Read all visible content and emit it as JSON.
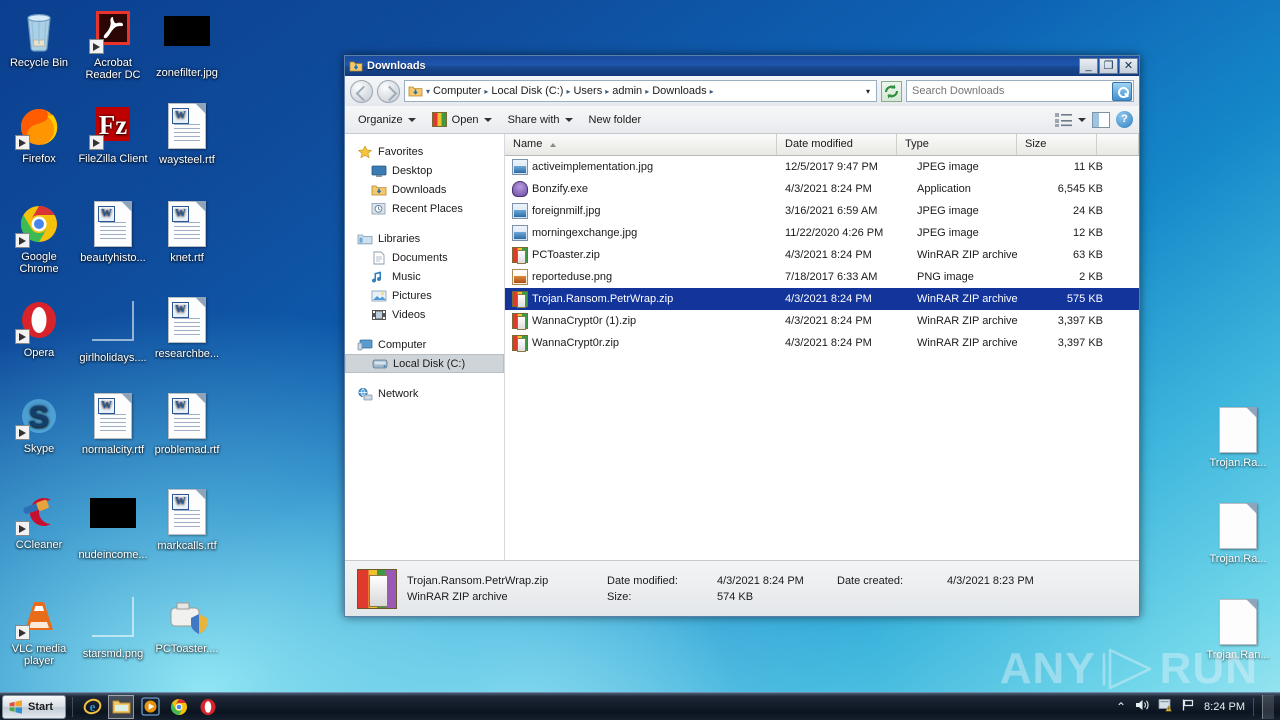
{
  "desktop": {
    "icons": [
      {
        "label": "Recycle Bin",
        "icon": "recycle-bin-icon",
        "kind": "recycle"
      },
      {
        "label": "Acrobat Reader DC",
        "icon": "acrobat-reader-icon",
        "kind": "acrobat"
      },
      {
        "label": "zonefilter.jpg",
        "icon": "image-file-icon",
        "kind": "black"
      },
      {
        "label": "Firefox",
        "icon": "firefox-icon",
        "kind": "firefox"
      },
      {
        "label": "FileZilla Client",
        "icon": "filezilla-icon",
        "kind": "filezilla"
      },
      {
        "label": "waysteel.rtf",
        "icon": "rtf-document-icon",
        "kind": "word"
      },
      {
        "label": "Google Chrome",
        "icon": "chrome-icon",
        "kind": "chrome"
      },
      {
        "label": "beautyhisto...",
        "icon": "rtf-document-icon",
        "kind": "word"
      },
      {
        "label": "knet.rtf",
        "icon": "rtf-document-icon",
        "kind": "word"
      },
      {
        "label": "Opera",
        "icon": "opera-icon",
        "kind": "opera"
      },
      {
        "label": "girlholidays....",
        "icon": "image-file-icon",
        "kind": "empty"
      },
      {
        "label": "researchbe...",
        "icon": "rtf-document-icon",
        "kind": "word"
      },
      {
        "label": "Skype",
        "icon": "skype-icon",
        "kind": "skype"
      },
      {
        "label": "normalcity.rtf",
        "icon": "rtf-document-icon",
        "kind": "word"
      },
      {
        "label": "problemad.rtf",
        "icon": "rtf-document-icon",
        "kind": "word"
      },
      {
        "label": "CCleaner",
        "icon": "ccleaner-icon",
        "kind": "ccleaner"
      },
      {
        "label": "nudeincome...",
        "icon": "image-file-icon",
        "kind": "black"
      },
      {
        "label": "markcalls.rtf",
        "icon": "rtf-document-icon",
        "kind": "word"
      },
      {
        "label": "VLC media player",
        "icon": "vlc-icon",
        "kind": "vlc"
      },
      {
        "label": "starsmd.png",
        "icon": "image-file-icon",
        "kind": "empty"
      },
      {
        "label": "PCToaster....",
        "icon": "pctoaster-icon",
        "kind": "toaster"
      }
    ],
    "right_icons": [
      {
        "label": "Trojan.Ra...",
        "icon": "blank-file-icon"
      },
      {
        "label": "Trojan.Ra...",
        "icon": "blank-file-icon"
      },
      {
        "label": "Trojan.Ran...",
        "icon": "blank-file-icon"
      }
    ],
    "watermark": {
      "text_left": "ANY",
      "text_right": "RUN",
      "icon": "play-triangle-icon"
    }
  },
  "window": {
    "title": "Downloads",
    "title_icon": "downloads-folder-icon",
    "controls": {
      "minimize": "_",
      "maximize": "❐",
      "close": "✕"
    },
    "address": {
      "folder_icon": "downloads-folder-icon",
      "crumbs": [
        "Computer",
        "Local Disk (C:)",
        "Users",
        "admin",
        "Downloads"
      ],
      "separator": "▸",
      "dropdown_caret": "▾",
      "refresh_icon": "refresh-icon"
    },
    "search": {
      "placeholder": "Search Downloads",
      "value": "",
      "icon": "search-icon"
    },
    "toolbar": {
      "organize": "Organize",
      "open": "Open",
      "open_icon": "winrar-open-icon",
      "share_with": "Share with",
      "new_folder": "New folder",
      "view_icon": "view-list-icon",
      "preview_pane_icon": "preview-pane-icon",
      "help_icon": "help-icon",
      "help_glyph": "?"
    },
    "nav": {
      "groups": [
        {
          "header": {
            "label": "Favorites",
            "icon": "star-icon"
          },
          "items": [
            {
              "label": "Desktop",
              "icon": "desktop-icon"
            },
            {
              "label": "Downloads",
              "icon": "downloads-folder-icon"
            },
            {
              "label": "Recent Places",
              "icon": "recent-places-icon"
            }
          ]
        },
        {
          "header": {
            "label": "Libraries",
            "icon": "libraries-icon"
          },
          "items": [
            {
              "label": "Documents",
              "icon": "documents-icon"
            },
            {
              "label": "Music",
              "icon": "music-icon"
            },
            {
              "label": "Pictures",
              "icon": "pictures-icon"
            },
            {
              "label": "Videos",
              "icon": "videos-icon"
            }
          ]
        },
        {
          "header": {
            "label": "Computer",
            "icon": "computer-icon"
          },
          "items": [
            {
              "label": "Local Disk (C:)",
              "icon": "hard-disk-icon",
              "selected": true
            }
          ]
        },
        {
          "header": {
            "label": "Network",
            "icon": "network-icon"
          },
          "items": []
        }
      ]
    },
    "columns": [
      {
        "label": "Name",
        "sorted": "asc"
      },
      {
        "label": "Date modified"
      },
      {
        "label": "Type"
      },
      {
        "label": "Size"
      }
    ],
    "files": [
      {
        "name": "activeimplementation.jpg",
        "modified": "12/5/2017 9:47 PM",
        "type": "JPEG image",
        "size": "11 KB",
        "icon": "jpeg"
      },
      {
        "name": "Bonzify.exe",
        "modified": "4/3/2021 8:24 PM",
        "type": "Application",
        "size": "6,545 KB",
        "icon": "exe"
      },
      {
        "name": "foreignmilf.jpg",
        "modified": "3/16/2021 6:59 AM",
        "type": "JPEG image",
        "size": "24 KB",
        "icon": "jpeg"
      },
      {
        "name": "morningexchange.jpg",
        "modified": "11/22/2020 4:26 PM",
        "type": "JPEG image",
        "size": "12 KB",
        "icon": "jpeg"
      },
      {
        "name": "PCToaster.zip",
        "modified": "4/3/2021 8:24 PM",
        "type": "WinRAR ZIP archive",
        "size": "63 KB",
        "icon": "zip"
      },
      {
        "name": "reporteduse.png",
        "modified": "7/18/2017 6:33 AM",
        "type": "PNG image",
        "size": "2 KB",
        "icon": "png"
      },
      {
        "name": "Trojan.Ransom.PetrWrap.zip",
        "modified": "4/3/2021 8:24 PM",
        "type": "WinRAR ZIP archive",
        "size": "575 KB",
        "icon": "zip",
        "selected": true
      },
      {
        "name": "WannaCrypt0r (1).zip",
        "modified": "4/3/2021 8:24 PM",
        "type": "WinRAR ZIP archive",
        "size": "3,397 KB",
        "icon": "zip"
      },
      {
        "name": "WannaCrypt0r.zip",
        "modified": "4/3/2021 8:24 PM",
        "type": "WinRAR ZIP archive",
        "size": "3,397 KB",
        "icon": "zip"
      }
    ],
    "details": {
      "icon": "winrar-archive-icon",
      "filename": "Trojan.Ransom.PetrWrap.zip",
      "date_modified_label": "Date modified:",
      "date_modified_value": "4/3/2021 8:24 PM",
      "date_created_label": "Date created:",
      "date_created_value": "4/3/2021 8:23 PM",
      "type": "WinRAR ZIP archive",
      "size_label": "Size:",
      "size_value": "574 KB"
    }
  },
  "taskbar": {
    "start_label": "Start",
    "start_icon": "windows-logo-icon",
    "quick_launch": [
      {
        "icon": "internet-explorer-icon",
        "name": "internet-explorer"
      },
      {
        "icon": "explorer-icon",
        "name": "windows-explorer",
        "active": true
      },
      {
        "icon": "media-player-icon",
        "name": "windows-media-player"
      },
      {
        "icon": "chrome-icon",
        "name": "google-chrome"
      },
      {
        "icon": "opera-icon",
        "name": "opera"
      }
    ],
    "tray": {
      "show_hidden_icon": "chevron-up-icon",
      "show_hidden_glyph": "⌃",
      "volume_icon": "volume-icon",
      "action_center_icon": "action-center-flag-icon",
      "network_icon": "network-flag-icon",
      "clock": "8:24 PM",
      "show_desktop": "show-desktop-button"
    }
  }
}
